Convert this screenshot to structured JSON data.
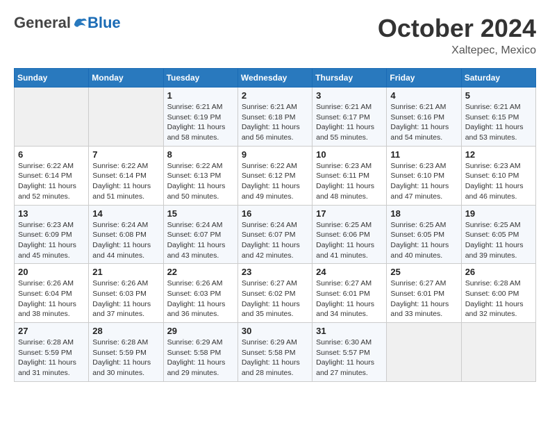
{
  "header": {
    "logo_general": "General",
    "logo_blue": "Blue",
    "month_title": "October 2024",
    "location": "Xaltepec, Mexico"
  },
  "weekdays": [
    "Sunday",
    "Monday",
    "Tuesday",
    "Wednesday",
    "Thursday",
    "Friday",
    "Saturday"
  ],
  "weeks": [
    [
      {
        "day": "",
        "empty": true
      },
      {
        "day": "",
        "empty": true
      },
      {
        "day": "1",
        "sunrise": "6:21 AM",
        "sunset": "6:19 PM",
        "daylight": "11 hours and 58 minutes."
      },
      {
        "day": "2",
        "sunrise": "6:21 AM",
        "sunset": "6:18 PM",
        "daylight": "11 hours and 56 minutes."
      },
      {
        "day": "3",
        "sunrise": "6:21 AM",
        "sunset": "6:17 PM",
        "daylight": "11 hours and 55 minutes."
      },
      {
        "day": "4",
        "sunrise": "6:21 AM",
        "sunset": "6:16 PM",
        "daylight": "11 hours and 54 minutes."
      },
      {
        "day": "5",
        "sunrise": "6:21 AM",
        "sunset": "6:15 PM",
        "daylight": "11 hours and 53 minutes."
      }
    ],
    [
      {
        "day": "6",
        "sunrise": "6:22 AM",
        "sunset": "6:14 PM",
        "daylight": "11 hours and 52 minutes."
      },
      {
        "day": "7",
        "sunrise": "6:22 AM",
        "sunset": "6:14 PM",
        "daylight": "11 hours and 51 minutes."
      },
      {
        "day": "8",
        "sunrise": "6:22 AM",
        "sunset": "6:13 PM",
        "daylight": "11 hours and 50 minutes."
      },
      {
        "day": "9",
        "sunrise": "6:22 AM",
        "sunset": "6:12 PM",
        "daylight": "11 hours and 49 minutes."
      },
      {
        "day": "10",
        "sunrise": "6:23 AM",
        "sunset": "6:11 PM",
        "daylight": "11 hours and 48 minutes."
      },
      {
        "day": "11",
        "sunrise": "6:23 AM",
        "sunset": "6:10 PM",
        "daylight": "11 hours and 47 minutes."
      },
      {
        "day": "12",
        "sunrise": "6:23 AM",
        "sunset": "6:10 PM",
        "daylight": "11 hours and 46 minutes."
      }
    ],
    [
      {
        "day": "13",
        "sunrise": "6:23 AM",
        "sunset": "6:09 PM",
        "daylight": "11 hours and 45 minutes."
      },
      {
        "day": "14",
        "sunrise": "6:24 AM",
        "sunset": "6:08 PM",
        "daylight": "11 hours and 44 minutes."
      },
      {
        "day": "15",
        "sunrise": "6:24 AM",
        "sunset": "6:07 PM",
        "daylight": "11 hours and 43 minutes."
      },
      {
        "day": "16",
        "sunrise": "6:24 AM",
        "sunset": "6:07 PM",
        "daylight": "11 hours and 42 minutes."
      },
      {
        "day": "17",
        "sunrise": "6:25 AM",
        "sunset": "6:06 PM",
        "daylight": "11 hours and 41 minutes."
      },
      {
        "day": "18",
        "sunrise": "6:25 AM",
        "sunset": "6:05 PM",
        "daylight": "11 hours and 40 minutes."
      },
      {
        "day": "19",
        "sunrise": "6:25 AM",
        "sunset": "6:05 PM",
        "daylight": "11 hours and 39 minutes."
      }
    ],
    [
      {
        "day": "20",
        "sunrise": "6:26 AM",
        "sunset": "6:04 PM",
        "daylight": "11 hours and 38 minutes."
      },
      {
        "day": "21",
        "sunrise": "6:26 AM",
        "sunset": "6:03 PM",
        "daylight": "11 hours and 37 minutes."
      },
      {
        "day": "22",
        "sunrise": "6:26 AM",
        "sunset": "6:03 PM",
        "daylight": "11 hours and 36 minutes."
      },
      {
        "day": "23",
        "sunrise": "6:27 AM",
        "sunset": "6:02 PM",
        "daylight": "11 hours and 35 minutes."
      },
      {
        "day": "24",
        "sunrise": "6:27 AM",
        "sunset": "6:01 PM",
        "daylight": "11 hours and 34 minutes."
      },
      {
        "day": "25",
        "sunrise": "6:27 AM",
        "sunset": "6:01 PM",
        "daylight": "11 hours and 33 minutes."
      },
      {
        "day": "26",
        "sunrise": "6:28 AM",
        "sunset": "6:00 PM",
        "daylight": "11 hours and 32 minutes."
      }
    ],
    [
      {
        "day": "27",
        "sunrise": "6:28 AM",
        "sunset": "5:59 PM",
        "daylight": "11 hours and 31 minutes."
      },
      {
        "day": "28",
        "sunrise": "6:28 AM",
        "sunset": "5:59 PM",
        "daylight": "11 hours and 30 minutes."
      },
      {
        "day": "29",
        "sunrise": "6:29 AM",
        "sunset": "5:58 PM",
        "daylight": "11 hours and 29 minutes."
      },
      {
        "day": "30",
        "sunrise": "6:29 AM",
        "sunset": "5:58 PM",
        "daylight": "11 hours and 28 minutes."
      },
      {
        "day": "31",
        "sunrise": "6:30 AM",
        "sunset": "5:57 PM",
        "daylight": "11 hours and 27 minutes."
      },
      {
        "day": "",
        "empty": true
      },
      {
        "day": "",
        "empty": true
      }
    ]
  ],
  "labels": {
    "sunrise": "Sunrise:",
    "sunset": "Sunset:",
    "daylight": "Daylight:"
  }
}
